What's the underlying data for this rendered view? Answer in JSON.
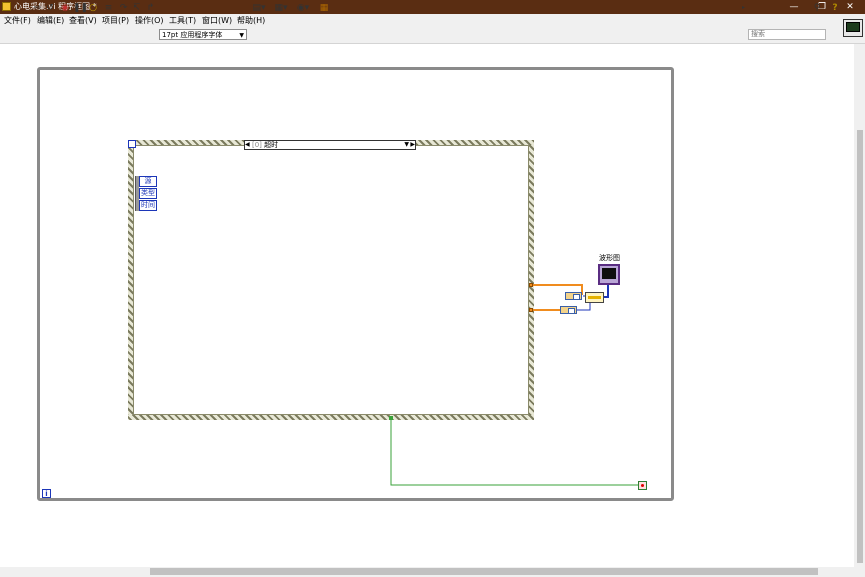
{
  "window": {
    "title": "心电采集.vi 程序框图 *",
    "icon": "labview-vi-icon",
    "controls": [
      "minimize",
      "restore",
      "close"
    ]
  },
  "menu": [
    {
      "label": "文件(F)"
    },
    {
      "label": "编辑(E)"
    },
    {
      "label": "查看(V)"
    },
    {
      "label": "项目(P)"
    },
    {
      "label": "操作(O)"
    },
    {
      "label": "工具(T)"
    },
    {
      "label": "窗口(W)"
    },
    {
      "label": "帮助(H)"
    }
  ],
  "toolbar": {
    "font": "17pt 应用程序字体",
    "search_placeholder": "搜索",
    "icons": [
      "run-icon",
      "run-continuously-icon",
      "abort-icon",
      "pause-icon",
      "highlight-execution-icon",
      "retain-wire-values-icon",
      "step-into-icon",
      "step-over-icon",
      "step-out-icon",
      "align-objects-icon",
      "distribute-objects-icon",
      "reorder-icon",
      "cleanup-diagram-icon",
      "search-icon",
      "help-icon"
    ]
  },
  "diagram": {
    "event_case": {
      "case_index": "[0]",
      "case_name": "超时"
    },
    "event_data_node": [
      "源",
      "类型",
      "时间"
    ],
    "graph_terminal_label": "波形图"
  }
}
